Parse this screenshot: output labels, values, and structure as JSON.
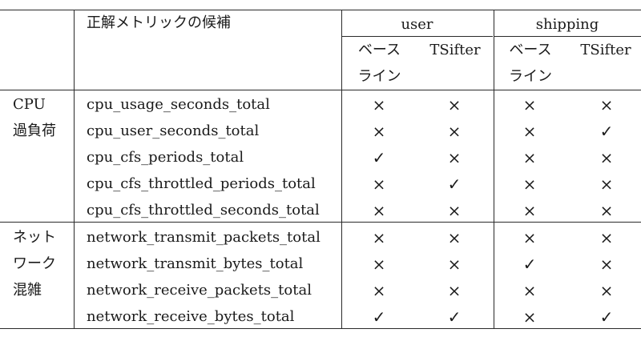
{
  "table": {
    "header": {
      "metric_col": "正解メトリックの候補",
      "groups": [
        "user",
        "shipping"
      ],
      "subcols": [
        {
          "line1": "ベース",
          "line2": "ライン"
        },
        {
          "line1": "TSifter",
          "line2": ""
        },
        {
          "line1": "ベース",
          "line2": "ライン"
        },
        {
          "line1": "TSifter",
          "line2": ""
        }
      ]
    },
    "sections": [
      {
        "label_lines": [
          "CPU",
          "過負荷"
        ],
        "rows": [
          {
            "metric": "cpu_usage_seconds_total",
            "marks": [
              "×",
              "×",
              "×",
              "×"
            ]
          },
          {
            "metric": "cpu_user_seconds_total",
            "marks": [
              "×",
              "×",
              "×",
              "✓"
            ]
          },
          {
            "metric": "cpu_cfs_periods_total",
            "marks": [
              "✓",
              "×",
              "×",
              "×"
            ]
          },
          {
            "metric": "cpu_cfs_throttled_periods_total",
            "marks": [
              "×",
              "✓",
              "×",
              "×"
            ]
          },
          {
            "metric": "cpu_cfs_throttled_seconds_total",
            "marks": [
              "×",
              "×",
              "×",
              "×"
            ]
          }
        ]
      },
      {
        "label_lines": [
          "ネット",
          "ワーク",
          "混雑"
        ],
        "rows": [
          {
            "metric": "network_transmit_packets_total",
            "marks": [
              "×",
              "×",
              "×",
              "×"
            ]
          },
          {
            "metric": "network_transmit_bytes_total",
            "marks": [
              "×",
              "×",
              "✓",
              "×"
            ]
          },
          {
            "metric": "network_receive_packets_total",
            "marks": [
              "×",
              "×",
              "×",
              "×"
            ]
          },
          {
            "metric": "network_receive_bytes_total",
            "marks": [
              "✓",
              "✓",
              "×",
              "✓"
            ]
          }
        ]
      }
    ]
  }
}
